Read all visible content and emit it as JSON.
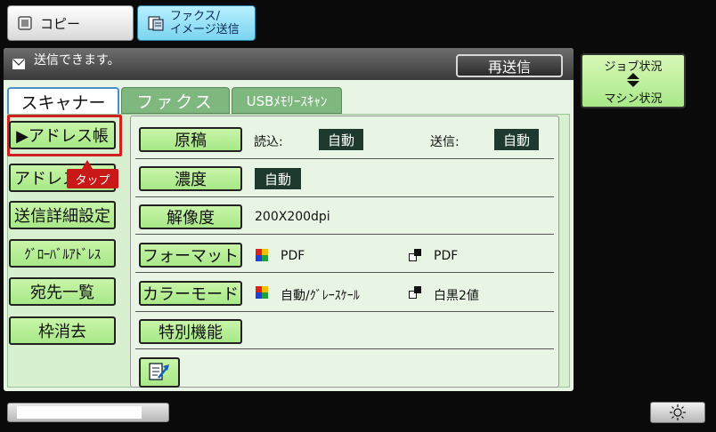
{
  "top_tabs": {
    "copy_label": "コピー",
    "fax_label_line1": "ファクス/",
    "fax_label_line2": "イメージ送信"
  },
  "status": {
    "message": "送信できます。",
    "resend_label": "再送信"
  },
  "tabs": [
    {
      "label": "スキャナー",
      "active": true
    },
    {
      "label": "ファクス",
      "active": false
    },
    {
      "label": "USBﾒﾓﾘｰｽｷｬﾝ",
      "active": false
    }
  ],
  "left_buttons": [
    {
      "label": "▶アドレス帳",
      "highlighted": true
    },
    {
      "label": "アドレス入力"
    },
    {
      "label": "送信詳細設定"
    },
    {
      "label": "ｸﾞﾛｰﾊﾞﾙｱﾄﾞﾚｽ"
    },
    {
      "label": "宛先一覧"
    },
    {
      "label": "枠消去"
    }
  ],
  "tap_callout": "タップ",
  "settings": {
    "original": {
      "label": "原稿",
      "read_label": "読込:",
      "read_value": "自動",
      "send_label": "送信:",
      "send_value": "自動"
    },
    "density": {
      "label": "濃度",
      "value": "自動"
    },
    "resolution": {
      "label": "解像度",
      "value": "200X200dpi"
    },
    "format": {
      "label": "フォーマット",
      "color_value": "PDF",
      "bw_value": "PDF"
    },
    "color_mode": {
      "label": "カラーモード",
      "color_value": "自動/ｸﾞﾚｰｽｹｰﾙ",
      "bw_value": "白黒2値"
    },
    "special": {
      "label": "特別機能"
    }
  },
  "right_panel": {
    "job_status_label": "ジョブ状況",
    "machine_status_label": "マシン状況"
  },
  "bottom": {
    "progress_fraction": 0.78
  },
  "colors": {
    "button_green": "#b8ee98",
    "highlight_red": "#d02020",
    "value_box": "#1e3a2e",
    "fax_tab_blue": "#7ad4f0"
  }
}
